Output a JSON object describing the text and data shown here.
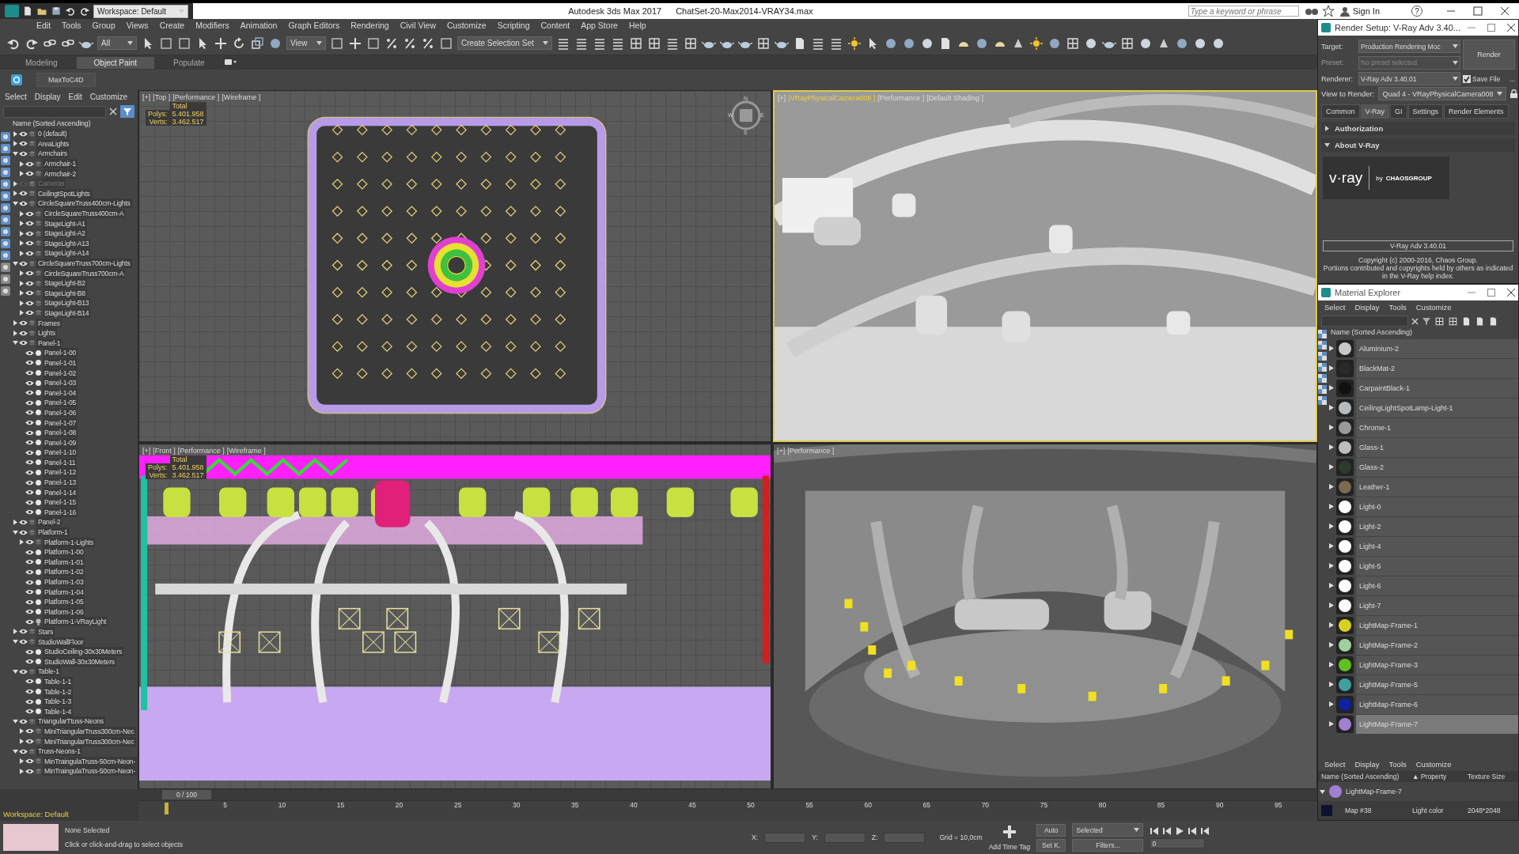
{
  "title_bar": {
    "workspace": "Workspace: Default",
    "app": "Autodesk 3ds Max 2017",
    "file": "ChatSet-20-Max2014-VRAY34.max",
    "search": {
      "placeholder": "Type a keyword or phrase"
    },
    "sign_in": "Sign In",
    "help": "?"
  },
  "menu": [
    "Edit",
    "Tools",
    "Group",
    "Views",
    "Create",
    "Modifiers",
    "Animation",
    "Graph Editors",
    "Rendering",
    "Civil View",
    "Customize",
    "Scripting",
    "Content",
    "App Store",
    "Help"
  ],
  "toolbar": {
    "filter": "All",
    "reference": "View",
    "selection_set": "Create Selection Set"
  },
  "ribbon_tabs": [
    {
      "label": "Modeling",
      "selected": false
    },
    {
      "label": "Object Paint",
      "selected": true
    },
    {
      "label": "Populate",
      "selected": false
    }
  ],
  "plugin_button": "MaxToC4D",
  "scene_explorer": {
    "menu": [
      "Select",
      "Display",
      "Edit",
      "Customize"
    ],
    "header": "Name (Sorted Ascending)",
    "tree": [
      {
        "name": "0 (default)",
        "kind": "layer",
        "expanded": false,
        "hidden": false
      },
      {
        "name": "AreaLights",
        "kind": "layer",
        "expanded": false,
        "hidden": false
      },
      {
        "name": "Armchairs",
        "kind": "layer",
        "expanded": true,
        "hidden": false,
        "children": [
          {
            "name": "Armchair-1",
            "kind": "layer",
            "expanded": false,
            "hidden": false
          },
          {
            "name": "Armchair-2",
            "kind": "layer",
            "expanded": false,
            "hidden": false
          }
        ]
      },
      {
        "name": "Cameras",
        "kind": "layer",
        "expanded": false,
        "hidden": true
      },
      {
        "name": "CeilingtSpotLights",
        "kind": "layer",
        "expanded": false,
        "hidden": false
      },
      {
        "name": "CircleSquareTruss400cm-Lights",
        "kind": "layer",
        "expanded": true,
        "hidden": false,
        "children": [
          {
            "name": "CircleSquareTruss400cm-A",
            "kind": "layer",
            "expanded": false,
            "hidden": false
          },
          {
            "name": "StageLight-A1",
            "kind": "layer",
            "expanded": false,
            "hidden": false
          },
          {
            "name": "StageLight-A2",
            "kind": "layer",
            "expanded": false,
            "hidden": false
          },
          {
            "name": "StageLight-A13",
            "kind": "layer",
            "expanded": false,
            "hidden": false
          },
          {
            "name": "StageLight-A14",
            "kind": "layer",
            "expanded": false,
            "hidden": false
          }
        ]
      },
      {
        "name": "CircleSquareTruss700cm-Lights",
        "kind": "layer",
        "expanded": true,
        "hidden": false,
        "children": [
          {
            "name": "CircleSquareTruss700cm-A",
            "kind": "layer",
            "expanded": false,
            "hidden": false
          },
          {
            "name": "StageLight-B2",
            "kind": "layer",
            "expanded": false,
            "hidden": false
          },
          {
            "name": "StageLight-B8",
            "kind": "layer",
            "expanded": false,
            "hidden": false
          },
          {
            "name": "StageLight-B13",
            "kind": "layer",
            "expanded": false,
            "hidden": false
          },
          {
            "name": "StageLight-B14",
            "kind": "layer",
            "expanded": false,
            "hidden": false
          }
        ]
      },
      {
        "name": "Frames",
        "kind": "layer",
        "expanded": false,
        "hidden": false
      },
      {
        "name": "Lights",
        "kind": "layer",
        "expanded": false,
        "hidden": false
      },
      {
        "name": "Panel-1",
        "kind": "layer",
        "expanded": true,
        "hidden": false,
        "children": [
          {
            "name": "Panel-1-00",
            "kind": "object",
            "hidden": false
          },
          {
            "name": "Panel-1-01",
            "kind": "object",
            "hidden": false
          },
          {
            "name": "Panel-1-02",
            "kind": "object",
            "hidden": false
          },
          {
            "name": "Panel-1-03",
            "kind": "object",
            "hidden": false
          },
          {
            "name": "Panel-1-04",
            "kind": "object",
            "hidden": false
          },
          {
            "name": "Panel-1-05",
            "kind": "object",
            "hidden": false
          },
          {
            "name": "Panel-1-06",
            "kind": "object",
            "hidden": false
          },
          {
            "name": "Panel-1-07",
            "kind": "object",
            "hidden": false
          },
          {
            "name": "Panel-1-08",
            "kind": "object",
            "hidden": false
          },
          {
            "name": "Panel-1-09",
            "kind": "object",
            "hidden": false
          },
          {
            "name": "Panel-1-10",
            "kind": "object",
            "hidden": false
          },
          {
            "name": "Panel-1-11",
            "kind": "object",
            "hidden": false
          },
          {
            "name": "Panel-1-12",
            "kind": "object",
            "hidden": false
          },
          {
            "name": "Panel-1-13",
            "kind": "object",
            "hidden": false
          },
          {
            "name": "Panel-1-14",
            "kind": "object",
            "hidden": false
          },
          {
            "name": "Panel-1-15",
            "kind": "object",
            "hidden": false
          },
          {
            "name": "Panel-1-16",
            "kind": "object",
            "hidden": false
          }
        ]
      },
      {
        "name": "Panel-2",
        "kind": "layer",
        "expanded": false,
        "hidden": false
      },
      {
        "name": "Platform-1",
        "kind": "layer",
        "expanded": true,
        "hidden": false,
        "children": [
          {
            "name": "Platform-1-Lights",
            "kind": "layer",
            "expanded": false,
            "hidden": false
          },
          {
            "name": "Platform-1-00",
            "kind": "object",
            "hidden": false
          },
          {
            "name": "Platform-1-01",
            "kind": "object",
            "hidden": false
          },
          {
            "name": "Platform-1-02",
            "kind": "object",
            "hidden": false
          },
          {
            "name": "Platform-1-03",
            "kind": "object",
            "hidden": false
          },
          {
            "name": "Platform-1-04",
            "kind": "object",
            "hidden": false
          },
          {
            "name": "Platform-1-05",
            "kind": "object",
            "hidden": false
          },
          {
            "name": "Platform-1-06",
            "kind": "object",
            "hidden": false
          },
          {
            "name": "Platform-1-VRayLight",
            "kind": "light",
            "hidden": false
          }
        ]
      },
      {
        "name": "Stars",
        "kind": "layer",
        "expanded": false,
        "hidden": false
      },
      {
        "name": "StudioWallFloor",
        "kind": "layer",
        "expanded": true,
        "hidden": false,
        "children": [
          {
            "name": "StudioCeiling-30x30Meters",
            "kind": "object",
            "hidden": false
          },
          {
            "name": "StudioWall-30x30Meters",
            "kind": "object",
            "hidden": false
          }
        ]
      },
      {
        "name": "Table-1",
        "kind": "layer",
        "expanded": true,
        "hidden": false,
        "children": [
          {
            "name": "Table-1-1",
            "kind": "object",
            "hidden": false
          },
          {
            "name": "Table-1-2",
            "kind": "object",
            "hidden": false
          },
          {
            "name": "Table-1-3",
            "kind": "object",
            "hidden": false
          },
          {
            "name": "Table-1-4",
            "kind": "object",
            "hidden": false
          }
        ]
      },
      {
        "name": "TriangularTtuss-Neons",
        "kind": "layer",
        "expanded": true,
        "hidden": false,
        "children": [
          {
            "name": "MiniTriangularTruss300cm-Nec",
            "kind": "layer",
            "expanded": false,
            "hidden": false
          },
          {
            "name": "MiniTriangularTruss300cm-Nec",
            "kind": "layer",
            "expanded": false,
            "hidden": false
          }
        ]
      },
      {
        "name": "Truss-Neons-1",
        "kind": "layer",
        "expanded": true,
        "hidden": false,
        "children": [
          {
            "name": "MinTraingulaTruss-50cm-Neon-",
            "kind": "layer",
            "expanded": false,
            "hidden": false
          },
          {
            "name": "MinTraingulaTruss-50cm-Neon-",
            "kind": "layer",
            "expanded": false,
            "hidden": false
          }
        ]
      }
    ]
  },
  "viewports": [
    {
      "kind": "top",
      "active": false,
      "labels": [
        "[+]",
        "[Top ]",
        "[Performance ]",
        "[Wireframe ]"
      ],
      "stats": {
        "title": "Total",
        "rows": [
          {
            "label": "Polys:",
            "value": "5.401.958"
          },
          {
            "label": "Verts:",
            "value": "3.462.517"
          }
        ]
      },
      "compass": [
        "N",
        "W",
        "E",
        "S"
      ]
    },
    {
      "kind": "camera",
      "active": true,
      "labels": [
        "[+]",
        "[VRayPhysicalCamera008 ]",
        "[Performance ]",
        "[Default Shading ]"
      ]
    },
    {
      "kind": "front",
      "active": false,
      "labels": [
        "[+]",
        "[Front ]",
        "[Performance ]",
        "[Wireframe ]"
      ],
      "stats": {
        "title": "Total",
        "rows": [
          {
            "label": "Polys:",
            "value": "5.401.958"
          },
          {
            "label": "Verts:",
            "value": "3.462.517"
          }
        ]
      }
    },
    {
      "kind": "studio",
      "active": false,
      "labels": [
        "[+]",
        "[Performance ]"
      ]
    }
  ],
  "render_setup": {
    "title": "Render Setup: V-Ray Adv 3.40...",
    "fields": [
      {
        "label": "Target:",
        "value": "Production Rendering Moc",
        "disabled": false
      },
      {
        "label": "Preset:",
        "value": "No preset selected",
        "disabled": true
      },
      {
        "label": "Renderer:",
        "value": "V-Ray Adv 3.40.01",
        "disabled": false
      }
    ],
    "render_button": "Render",
    "save_file": {
      "label": "Save File",
      "checked": true
    },
    "more": "...",
    "view_to_render": {
      "label": "View to Render:",
      "value": "Quad 4 - VRayPhysicalCamera008"
    },
    "tabs": [
      {
        "label": "Common",
        "selected": false
      },
      {
        "label": "V-Ray",
        "selected": true
      },
      {
        "label": "GI",
        "selected": false
      },
      {
        "label": "Settings",
        "selected": false
      },
      {
        "label": "Render Elements",
        "selected": false
      }
    ],
    "rollouts": [
      {
        "title": "Authorization",
        "expanded": false
      },
      {
        "title": "About V-Ray",
        "expanded": true
      }
    ],
    "logo": {
      "name": "v·ray",
      "by": "by",
      "company": "CHAOSGROUP"
    },
    "version": "V-Ray Adv 3.40.01",
    "copyright": "Copyright (c) 2000-2016, Chaos Group.",
    "notice": "Portions contributed and copyrights held by others as indicated in the V-Ray help index."
  },
  "material_explorer": {
    "title": "Material Explorer",
    "menu": [
      "Select",
      "Display",
      "Tools",
      "Customize"
    ],
    "header": "Name (Sorted Ascending)",
    "items": [
      {
        "name": "Aluminium-2",
        "color": "#c8c8c8",
        "selected": false
      },
      {
        "name": "BlackMat-2",
        "color": "#2a2a2a",
        "selected": false
      },
      {
        "name": "CarpaintBlack-1",
        "color": "#111111",
        "selected": false
      },
      {
        "name": "CeilingLightSpotLamp-Light-1",
        "color": "#b4bcc0",
        "selected": false
      },
      {
        "name": "Chrome-1",
        "color": "#9a9a9a",
        "selected": false
      },
      {
        "name": "Glass-1",
        "color": "#bdbdbd",
        "selected": false
      },
      {
        "name": "Glass-2",
        "color": "#2e3a2e",
        "selected": false
      },
      {
        "name": "Leather-1",
        "color": "#7a6a50",
        "selected": false
      },
      {
        "name": "Light-0",
        "color": "#ffffff",
        "selected": false
      },
      {
        "name": "Light-2",
        "color": "#fefefe",
        "selected": false
      },
      {
        "name": "Light-4",
        "color": "#fdfdfd",
        "selected": false
      },
      {
        "name": "Light-5",
        "color": "#fcfcfc",
        "selected": false
      },
      {
        "name": "Light-6",
        "color": "#fbfbfb",
        "selected": false
      },
      {
        "name": "Light-7",
        "color": "#fafafa",
        "selected": false
      },
      {
        "name": "LightMap-Frame-1",
        "color": "#d8d020",
        "selected": false
      },
      {
        "name": "LightMap-Frame-2",
        "color": "#a0d0a0",
        "selected": false
      },
      {
        "name": "LightMap-Frame-3",
        "color": "#60c020",
        "selected": false
      },
      {
        "name": "LightMap-Frame-5",
        "color": "#40a0a0",
        "selected": false
      },
      {
        "name": "LightMap-Frame-6",
        "color": "#1020a0",
        "selected": false
      },
      {
        "name": "LightMap-Frame-7",
        "color": "#a080d0",
        "selected": true
      }
    ],
    "lower_menu": [
      "Select",
      "Display",
      "Tools",
      "Customize"
    ],
    "columns": [
      "Name (Sorted Ascending)",
      "▲ Property",
      "Texture Size"
    ],
    "parent": "LightMap-Frame-7",
    "map": {
      "name": "Map #38",
      "property": "Light color",
      "size": "2048*2048"
    }
  },
  "timeline": {
    "workspace": "Workspace: Default",
    "position": "0 / 100",
    "level": 0,
    "ticks": [
      "5",
      "10",
      "15",
      "20",
      "25",
      "30",
      "35",
      "40",
      "45",
      "50",
      "55",
      "60",
      "65",
      "70",
      "75",
      "80",
      "85",
      "90",
      "95"
    ]
  },
  "status": {
    "selection": "None Selected",
    "prompt": "Click or click-and-drag to select objects",
    "coords": [
      "X:",
      "Y:",
      "Z:"
    ],
    "grid": "Grid = 10,0cm",
    "time_tag": "Add Time Tag",
    "auto": "Auto",
    "set_key": "Set K.",
    "key_filter": "Selected",
    "filters": "Filters...",
    "frame": "0"
  }
}
